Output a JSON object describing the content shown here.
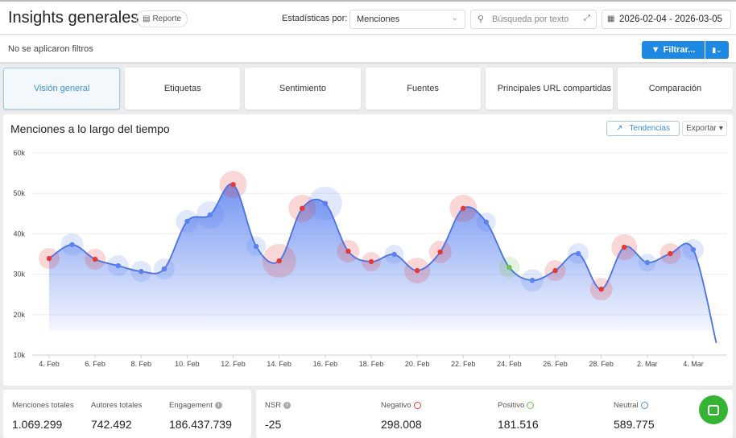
{
  "header": {
    "title": "Insights generales",
    "report_label": "Reporte",
    "stats_by_label": "Estadísticas por:",
    "stats_by_value": "Menciones",
    "search_placeholder": "Búsqueda por texto",
    "date_range": "2026-02-04 - 2026-03-05"
  },
  "filter_bar": {
    "status": "No se aplicaron filtros",
    "filter_label": "Filtrar..."
  },
  "tabs": [
    {
      "label": "Visión general",
      "active": true
    },
    {
      "label": "Etiquetas"
    },
    {
      "label": "Sentimiento"
    },
    {
      "label": "Fuentes"
    },
    {
      "label": "Principales URL compartidas"
    },
    {
      "label": "Comparación"
    }
  ],
  "chart_card": {
    "title": "Menciones a lo largo del tiempo",
    "trends_label": "Tendencias",
    "export_label": "Exportar"
  },
  "colors": {
    "accent": "#1e88e5",
    "line": "#4a72e0",
    "negative": "#e53935",
    "neutral": "#5b82f0",
    "positive": "#6cc24a"
  },
  "chart_data": {
    "type": "area",
    "ylim": [
      10000,
      60000
    ],
    "yticks": [
      "10k",
      "20k",
      "30k",
      "40k",
      "50k",
      "60k"
    ],
    "xtick_labels": [
      "4. Feb",
      "6. Feb",
      "8. Feb",
      "10. Feb",
      "12. Feb",
      "14. Feb",
      "16. Feb",
      "18. Feb",
      "20. Feb",
      "22. Feb",
      "24. Feb",
      "26. Feb",
      "28. Feb",
      "2. Mar",
      "4. Mar"
    ],
    "x": [
      "2026-02-04",
      "2026-02-05",
      "2026-02-06",
      "2026-02-07",
      "2026-02-08",
      "2026-02-09",
      "2026-02-10",
      "2026-02-11",
      "2026-02-12",
      "2026-02-13",
      "2026-02-14",
      "2026-02-15",
      "2026-02-16",
      "2026-02-17",
      "2026-02-18",
      "2026-02-19",
      "2026-02-20",
      "2026-02-21",
      "2026-02-22",
      "2026-02-23",
      "2026-02-24",
      "2026-02-25",
      "2026-02-26",
      "2026-02-27",
      "2026-02-28",
      "2026-03-01",
      "2026-03-02",
      "2026-03-03",
      "2026-03-04",
      "2026-03-05"
    ],
    "values": [
      33900,
      37300,
      33700,
      32100,
      30700,
      31300,
      43100,
      44700,
      52200,
      36900,
      33300,
      46300,
      47500,
      35700,
      33100,
      34900,
      30900,
      35500,
      46300,
      42900,
      31700,
      28500,
      30900,
      35100,
      26300,
      36700,
      32900,
      35100,
      36100,
      13000
    ],
    "sentiment": [
      "negative",
      "neutral",
      "negative",
      "neutral",
      "neutral",
      "neutral",
      "neutral",
      "neutral",
      "negative",
      "neutral",
      "negative",
      "negative",
      "neutral",
      "negative",
      "negative",
      "neutral",
      "negative",
      "negative",
      "negative",
      "neutral",
      "positive",
      "neutral",
      "negative",
      "neutral",
      "negative",
      "negative",
      "neutral",
      "negative",
      "neutral",
      null
    ],
    "grid": true
  },
  "stats_general": [
    {
      "label": "Menciones totales",
      "value": "1.069.299"
    },
    {
      "label": "Autores totales",
      "value": "742.492"
    },
    {
      "label": "Engagement",
      "value": "186.437.739",
      "info": true
    }
  ],
  "stats_sentiment": [
    {
      "label": "NSR",
      "value": "-25",
      "icon": "info-icon"
    },
    {
      "label": "Negativo",
      "value": "298.008",
      "icon": "sad-face-icon"
    },
    {
      "label": "Positivo",
      "value": "181.516",
      "icon": "happy-face-icon"
    },
    {
      "label": "Neutral",
      "value": "589.775",
      "icon": "neutral-face-icon"
    }
  ]
}
